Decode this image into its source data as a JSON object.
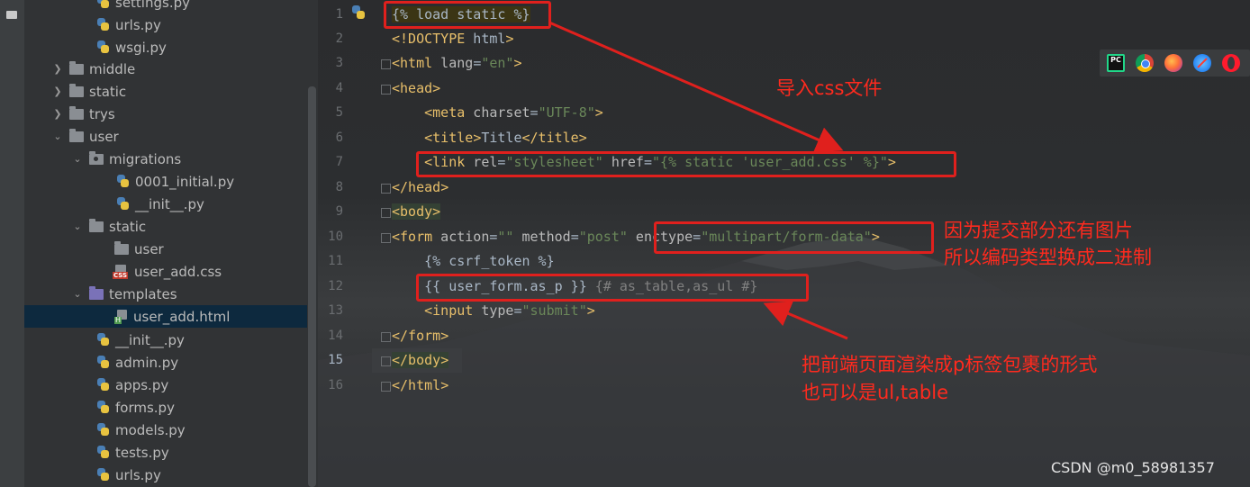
{
  "project_tree": {
    "items": [
      {
        "label": "settings.py",
        "type": "py",
        "depth": 3
      },
      {
        "label": "urls.py",
        "type": "py",
        "depth": 3
      },
      {
        "label": "wsgi.py",
        "type": "py",
        "depth": 3
      },
      {
        "label": "middle",
        "type": "folder",
        "depth": 1,
        "collapsed": true
      },
      {
        "label": "static",
        "type": "folder",
        "depth": 1,
        "collapsed": true
      },
      {
        "label": "trys",
        "type": "folder",
        "depth": 1,
        "collapsed": true
      },
      {
        "label": "user",
        "type": "folder",
        "depth": 1,
        "collapsed": false
      },
      {
        "label": "migrations",
        "type": "package",
        "depth": 2,
        "collapsed": false
      },
      {
        "label": "0001_initial.py",
        "type": "py",
        "depth": 3
      },
      {
        "label": "__init__.py",
        "type": "py",
        "depth": 3
      },
      {
        "label": "static",
        "type": "folder",
        "depth": 2,
        "collapsed": false
      },
      {
        "label": "user",
        "type": "folder",
        "depth": 3
      },
      {
        "label": "user_add.css",
        "type": "css",
        "depth": 3
      },
      {
        "label": "templates",
        "type": "template-folder",
        "depth": 2,
        "collapsed": false
      },
      {
        "label": "user_add.html",
        "type": "html",
        "depth": 3,
        "selected": true
      },
      {
        "label": "__init__.py",
        "type": "py",
        "depth": 2
      },
      {
        "label": "admin.py",
        "type": "py",
        "depth": 2
      },
      {
        "label": "apps.py",
        "type": "py",
        "depth": 2
      },
      {
        "label": "forms.py",
        "type": "py",
        "depth": 2
      },
      {
        "label": "models.py",
        "type": "py",
        "depth": 2
      },
      {
        "label": "tests.py",
        "type": "py",
        "depth": 2
      },
      {
        "label": "urls.py",
        "type": "py",
        "depth": 2
      }
    ]
  },
  "editor": {
    "current_line": 15,
    "line_numbers": [
      "1",
      "2",
      "3",
      "4",
      "5",
      "6",
      "7",
      "8",
      "9",
      "10",
      "11",
      "12",
      "13",
      "14",
      "15",
      "16"
    ],
    "lines": [
      "{% load static %}",
      "<!DOCTYPE html>",
      "<html lang=\"en\">",
      "<head>",
      "    <meta charset=\"UTF-8\">",
      "    <title>Title</title>",
      "    <link rel=\"stylesheet\" href=\"{% static 'user_add.css' %}\">",
      "</head>",
      "<body>",
      "<form action=\"\" method=\"post\" enctype=\"multipart/form-data\">",
      "    {% csrf_token %}",
      "    {{ user_form.as_p }} {# as_table,as_ul #}",
      "    <input type=\"submit\">",
      "</form>",
      "</body>",
      "</html>"
    ]
  },
  "annotations": {
    "css_import": "导入css文件",
    "enctype_line1": "因为提交部分还有图片",
    "enctype_line2": "所以编码类型换成二进制",
    "as_p_line1": "把前端页面渲染成p标签包裹的形式",
    "as_p_line2": "也可以是ul,table",
    "color": "#ff2a1e"
  },
  "browser_icons": [
    "pycharm-icon",
    "chrome-icon",
    "firefox-icon",
    "safari-icon",
    "opera-icon"
  ],
  "watermark": "CSDN @m0_58981357"
}
